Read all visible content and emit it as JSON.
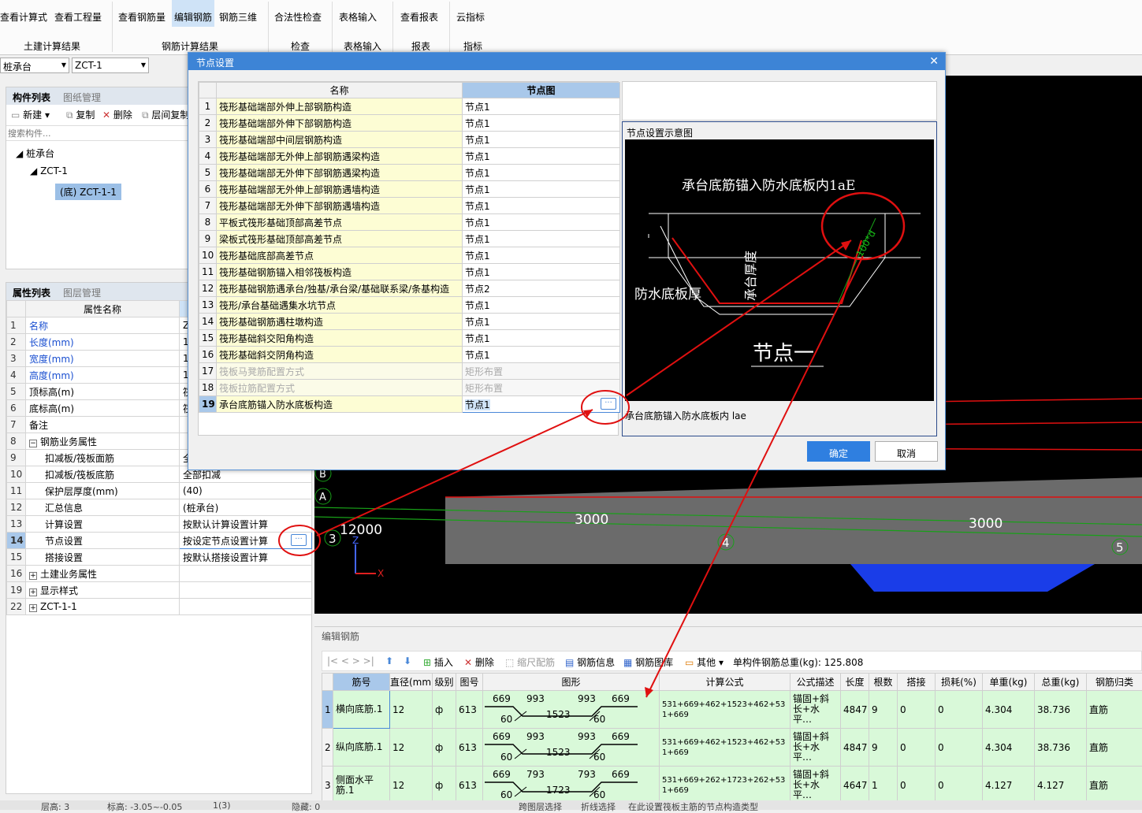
{
  "ribbon": {
    "buttons": [
      "查看计算式",
      "查看工程量",
      "查看钢筋量",
      "编辑钢筋",
      "钢筋三维",
      "合法性检查",
      "表格输入",
      "查看报表",
      "云指标"
    ],
    "groups": [
      "土建计算结果",
      "钢筋计算结果",
      "检查",
      "表格输入",
      "报表",
      "指标"
    ]
  },
  "combos": {
    "type": "桩承台",
    "name": "ZCT-1"
  },
  "component_panel": {
    "tabs": [
      "构件列表",
      "图纸管理"
    ],
    "tools": [
      "新建",
      "复制",
      "删除",
      "层间复制"
    ],
    "search_placeholder": "搜索构件...",
    "tree": [
      "桩承台",
      "ZCT-1",
      "(底) ZCT-1-1"
    ]
  },
  "property_panel": {
    "tabs": [
      "属性列表",
      "图层管理"
    ],
    "header": "属性名称",
    "rows": [
      {
        "n": "1",
        "name": "名称",
        "val": "Z"
      },
      {
        "n": "2",
        "name": "长度(mm)",
        "val": "1"
      },
      {
        "n": "3",
        "name": "宽度(mm)",
        "val": "1"
      },
      {
        "n": "4",
        "name": "高度(mm)",
        "val": "1"
      },
      {
        "n": "5",
        "name": "顶标高(m)",
        "val": "筏"
      },
      {
        "n": "6",
        "name": "底标高(m)",
        "val": "筏"
      },
      {
        "n": "7",
        "name": "备注",
        "val": ""
      },
      {
        "n": "8",
        "name": "钢筋业务属性",
        "val": ""
      },
      {
        "n": "9",
        "name": "扣减板/筏板面筋",
        "val": "全"
      },
      {
        "n": "10",
        "name": "扣减板/筏板底筋",
        "val": "全部扣减"
      },
      {
        "n": "11",
        "name": "保护层厚度(mm)",
        "val": "(40)"
      },
      {
        "n": "12",
        "name": "汇总信息",
        "val": "(桩承台)"
      },
      {
        "n": "13",
        "name": "计算设置",
        "val": "按默认计算设置计算"
      },
      {
        "n": "14",
        "name": "节点设置",
        "val": "按设定节点设置计算"
      },
      {
        "n": "15",
        "name": "搭接设置",
        "val": "按默认搭接设置计算"
      },
      {
        "n": "16",
        "name": "土建业务属性",
        "val": ""
      },
      {
        "n": "19",
        "name": "显示样式",
        "val": ""
      },
      {
        "n": "22",
        "name": "ZCT-1-1",
        "val": ""
      }
    ]
  },
  "dialog": {
    "title": "节点设置",
    "col_name": "名称",
    "col_node": "节点图",
    "rows": [
      {
        "n": "1",
        "name": "筏形基础端部外伸上部钢筋构造",
        "v": "节点1"
      },
      {
        "n": "2",
        "name": "筏形基础端部外伸下部钢筋构造",
        "v": "节点1"
      },
      {
        "n": "3",
        "name": "筏形基础端部中间层钢筋构造",
        "v": "节点1"
      },
      {
        "n": "4",
        "name": "筏形基础端部无外伸上部钢筋遇梁构造",
        "v": "节点1"
      },
      {
        "n": "5",
        "name": "筏形基础端部无外伸下部钢筋遇梁构造",
        "v": "节点1"
      },
      {
        "n": "6",
        "name": "筏形基础端部无外伸上部钢筋遇墙构造",
        "v": "节点1"
      },
      {
        "n": "7",
        "name": "筏形基础端部无外伸下部钢筋遇墙构造",
        "v": "节点1"
      },
      {
        "n": "8",
        "name": "平板式筏形基础顶部高差节点",
        "v": "节点1"
      },
      {
        "n": "9",
        "name": "梁板式筏形基础顶部高差节点",
        "v": "节点1"
      },
      {
        "n": "10",
        "name": "筏形基础底部高差节点",
        "v": "节点1"
      },
      {
        "n": "11",
        "name": "筏形基础钢筋锚入相邻筏板构造",
        "v": "节点1"
      },
      {
        "n": "12",
        "name": "筏形基础钢筋遇承台/独基/承台梁/基础联系梁/条基构造",
        "v": "节点2"
      },
      {
        "n": "13",
        "name": "筏形/承台基础遇集水坑节点",
        "v": "节点1"
      },
      {
        "n": "14",
        "name": "筏形基础钢筋遇柱墩构造",
        "v": "节点1"
      },
      {
        "n": "15",
        "name": "筏形基础斜交阳角构造",
        "v": "节点1"
      },
      {
        "n": "16",
        "name": "筏形基础斜交阴角构造",
        "v": "节点1"
      },
      {
        "n": "17",
        "name": "筏板马凳筋配置方式",
        "v": "矩形布置"
      },
      {
        "n": "18",
        "name": "筏板拉筋配置方式",
        "v": "矩形布置"
      },
      {
        "n": "19",
        "name": "承台底筋锚入防水底板构造",
        "v": "节点1"
      }
    ],
    "preview_title": "节点设置示意图",
    "preview_caption": "承台底筋锚入防水底板内 lae",
    "diagram": {
      "top": "承台底筋锚入防水底板内1aE",
      "left": "防水底板厚",
      "vert": "承台厚度",
      "dim": "100*d",
      "title": "节点一"
    },
    "ok": "确定",
    "cancel": "取消"
  },
  "viewport": {
    "labels": [
      "3000",
      "3000",
      "12000"
    ],
    "axes": [
      "B",
      "A",
      "3",
      "4",
      "5"
    ]
  },
  "rebar_panel": {
    "title": "编辑钢筋",
    "tools": [
      "插入",
      "删除",
      "缩尺配筋",
      "钢筋信息",
      "钢筋图库",
      "其他"
    ],
    "total": "单构件钢筋总重(kg): 125.808",
    "headers": [
      "筋号",
      "直径(mm)",
      "级别",
      "图号",
      "图形",
      "计算公式",
      "公式描述",
      "长度",
      "根数",
      "搭接",
      "损耗(%)",
      "单重(kg)",
      "总重(kg)",
      "钢筋归类"
    ],
    "rows": [
      {
        "n": "1",
        "name": "横向底筋.1",
        "d": "12",
        "lv": "ф",
        "fig": "613",
        "a": "669",
        "b": "993",
        "c": "993",
        "e": "669",
        "f": "60",
        "g": "1523",
        "h": "60",
        "formula": "531+669+462+1523+462+531+669",
        "desc": "锚固+斜长+水平…",
        "len": "4847",
        "cnt": "9",
        "lap": "0",
        "loss": "0",
        "unit": "4.304",
        "total": "38.736",
        "cls": "直筋"
      },
      {
        "n": "2",
        "name": "纵向底筋.1",
        "d": "12",
        "lv": "ф",
        "fig": "613",
        "a": "669",
        "b": "993",
        "c": "993",
        "e": "669",
        "f": "60",
        "g": "1523",
        "h": "60",
        "formula": "531+669+462+1523+462+531+669",
        "desc": "锚固+斜长+水平…",
        "len": "4847",
        "cnt": "9",
        "lap": "0",
        "loss": "0",
        "unit": "4.304",
        "total": "38.736",
        "cls": "直筋"
      },
      {
        "n": "3",
        "name": "侧面水平筋.1",
        "d": "12",
        "lv": "ф",
        "fig": "613",
        "a": "669",
        "b": "793",
        "c": "793",
        "e": "669",
        "f": "60",
        "g": "1723",
        "h": "60",
        "formula": "531+669+262+1723+262+531+669",
        "desc": "锚固+斜长+水平…",
        "len": "4647",
        "cnt": "1",
        "lap": "0",
        "loss": "0",
        "unit": "4.127",
        "total": "4.127",
        "cls": "直筋"
      }
    ]
  },
  "status": {
    "items": [
      "层高: 3",
      "标高: -3.05~-0.05",
      "1(3)",
      "隐藏: 0",
      "跨图层选择",
      "折线选择",
      "在此设置筏板主筋的节点构造类型"
    ]
  }
}
